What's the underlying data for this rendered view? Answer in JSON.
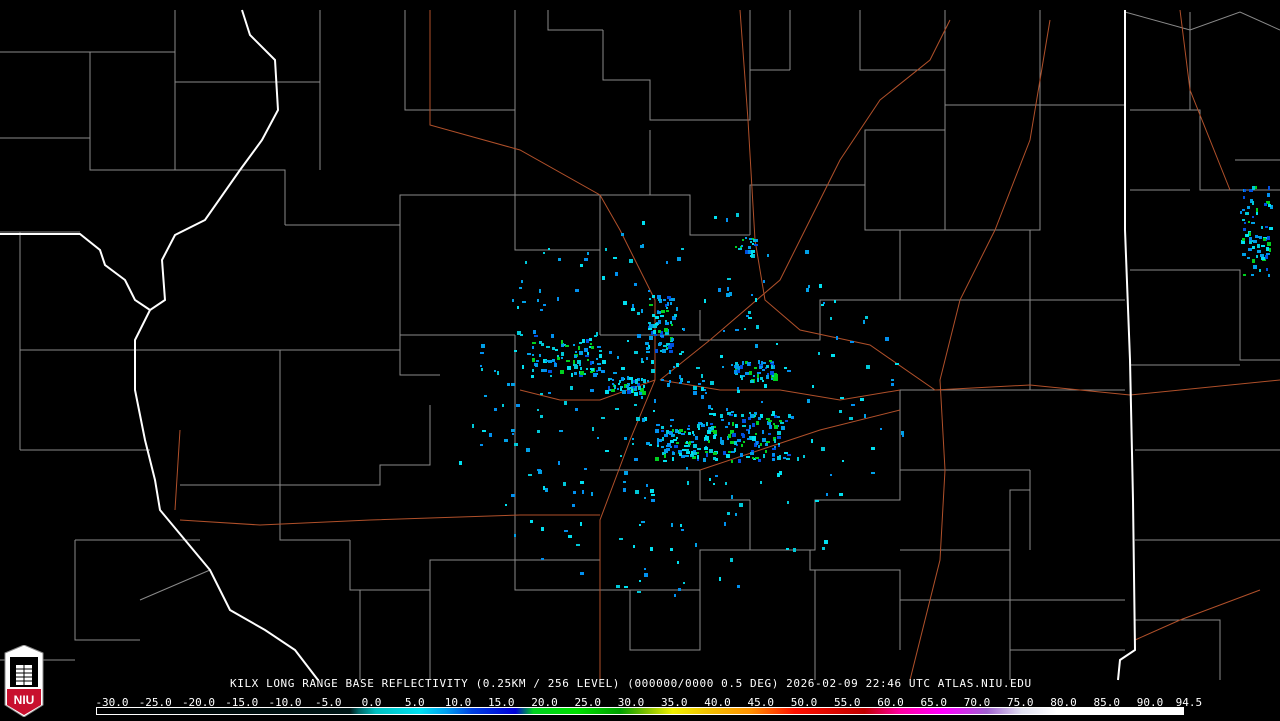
{
  "product": {
    "caption": "KILX LONG RANGE BASE REFLECTIVITY (0.25KM / 256 LEVEL) (000000/0000 0.5 DEG) 2026-02-09 22:46 UTC  ATLAS.NIU.EDU"
  },
  "logo": {
    "text": "NIU",
    "color": "#c8102e"
  },
  "colorbar": {
    "labels": [
      "-30.0",
      "-25.0",
      "-20.0",
      "-15.0",
      "-10.0",
      "-5.0",
      "0.0",
      "5.0",
      "10.0",
      "15.0",
      "20.0",
      "25.0",
      "30.0",
      "35.0",
      "40.0",
      "45.0",
      "50.0",
      "55.0",
      "60.0",
      "65.0",
      "70.0",
      "75.0",
      "80.0",
      "85.0",
      "90.0",
      "94.5"
    ],
    "min": -30,
    "max": 94.5,
    "stops": [
      {
        "v": -30,
        "c": "#000000"
      },
      {
        "v": -1,
        "c": "#001818"
      },
      {
        "v": 0,
        "c": "#006868"
      },
      {
        "v": 2,
        "c": "#00c0c0"
      },
      {
        "v": 7,
        "c": "#00e0f0"
      },
      {
        "v": 10,
        "c": "#00a0f0"
      },
      {
        "v": 13,
        "c": "#0040e0"
      },
      {
        "v": 18,
        "c": "#0000d8"
      },
      {
        "v": 19,
        "c": "#006878"
      },
      {
        "v": 20,
        "c": "#00d020"
      },
      {
        "v": 25,
        "c": "#00e000"
      },
      {
        "v": 30,
        "c": "#00a000"
      },
      {
        "v": 33,
        "c": "#80c000"
      },
      {
        "v": 36,
        "c": "#f0f000"
      },
      {
        "v": 40,
        "c": "#f0c000"
      },
      {
        "v": 45,
        "c": "#ff9000"
      },
      {
        "v": 50,
        "c": "#ff1000"
      },
      {
        "v": 58,
        "c": "#c00000"
      },
      {
        "v": 62,
        "c": "#ff00a0"
      },
      {
        "v": 67,
        "c": "#ff00ff"
      },
      {
        "v": 72,
        "c": "#a060d0"
      },
      {
        "v": 76,
        "c": "#e0e0f0"
      },
      {
        "v": 80,
        "c": "#ffffff"
      },
      {
        "v": 94.5,
        "c": "#ffffff"
      }
    ]
  }
}
